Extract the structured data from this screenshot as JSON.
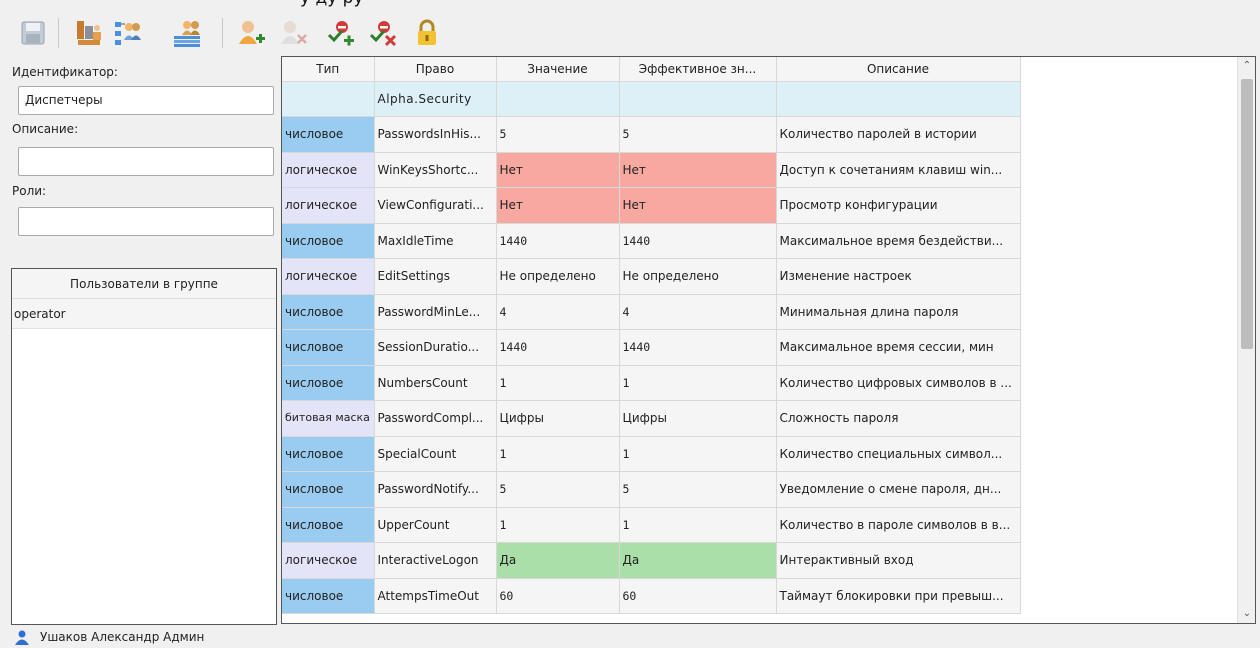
{
  "window": {
    "title_fragment": "у                 ду          ру"
  },
  "toolbar": {
    "buttons": [
      {
        "name": "save",
        "icon": "floppy-disk-icon",
        "enabled": false
      },
      {
        "name": "group-hierarchy",
        "icon": "building-group-icon",
        "enabled": true
      },
      {
        "name": "group-tree",
        "icon": "group-tree-icon",
        "enabled": true
      },
      {
        "name": "group-list",
        "icon": "group-list-icon",
        "enabled": true
      },
      {
        "name": "add-user",
        "icon": "user-add-icon",
        "enabled": true
      },
      {
        "name": "remove-user",
        "icon": "user-remove-icon",
        "enabled": false
      },
      {
        "name": "add-right",
        "icon": "right-add-icon",
        "enabled": true
      },
      {
        "name": "remove-right",
        "icon": "right-remove-icon",
        "enabled": true
      },
      {
        "name": "lock",
        "icon": "padlock-icon",
        "enabled": true
      }
    ]
  },
  "left": {
    "identifier_label": "Идентификатор:",
    "identifier_value": "Диспетчеры",
    "description_label": "Описание:",
    "description_value": "",
    "roles_label": "Роли:",
    "roles_value": "",
    "users_header": "Пользователи в группе",
    "users": [
      "operator"
    ]
  },
  "table": {
    "headers": [
      "Тип",
      "Право",
      "Значение",
      "Эффективное зн...",
      "Описание"
    ],
    "group_row": "Alpha.Security",
    "rows": [
      {
        "type": "числовое",
        "type_kind": "num",
        "right": "PasswordsInHis...",
        "value": "5",
        "effective": "5",
        "value_state": "",
        "value_mono": true,
        "desc": "Количество паролей в истории"
      },
      {
        "type": "логическое",
        "type_kind": "bool",
        "right": "WinKeysShortc...",
        "value": "Нет",
        "effective": "Нет",
        "value_state": "no",
        "value_mono": false,
        "desc": "Доступ к сочетаниям клавиш win..."
      },
      {
        "type": "логическое",
        "type_kind": "bool",
        "right": "ViewConfigurati...",
        "value": "Нет",
        "effective": "Нет",
        "value_state": "no",
        "value_mono": false,
        "desc": "Просмотр конфигурации"
      },
      {
        "type": "числовое",
        "type_kind": "num",
        "right": "MaxIdleTime",
        "value": "1440",
        "effective": "1440",
        "value_state": "",
        "value_mono": true,
        "desc": "Максимальное время бездействи..."
      },
      {
        "type": "логическое",
        "type_kind": "bool",
        "right": "EditSettings",
        "value": "Не определено",
        "effective": "Не определено",
        "value_state": "",
        "value_mono": false,
        "desc": "Изменение настроек"
      },
      {
        "type": "числовое",
        "type_kind": "num",
        "right": "PasswordMinLe...",
        "value": "4",
        "effective": "4",
        "value_state": "",
        "value_mono": true,
        "desc": "Минимальная длина пароля"
      },
      {
        "type": "числовое",
        "type_kind": "num",
        "right": "SessionDuratio...",
        "value": "1440",
        "effective": "1440",
        "value_state": "",
        "value_mono": true,
        "desc": "Максимальное время сессии, мин"
      },
      {
        "type": "числовое",
        "type_kind": "num",
        "right": "NumbersCount",
        "value": "1",
        "effective": "1",
        "value_state": "",
        "value_mono": true,
        "desc": "Количество цифровых символов в ..."
      },
      {
        "type": "битовая маска",
        "type_kind": "mask",
        "right": "PasswordCompl...",
        "value": "Цифры",
        "effective": "Цифры",
        "value_state": "",
        "value_mono": false,
        "desc": "Сложность пароля"
      },
      {
        "type": "числовое",
        "type_kind": "num",
        "right": "SpecialCount",
        "value": "1",
        "effective": "1",
        "value_state": "",
        "value_mono": true,
        "desc": "Количество специальных символ..."
      },
      {
        "type": "числовое",
        "type_kind": "num",
        "right": "PasswordNotify...",
        "value": "5",
        "effective": "5",
        "value_state": "",
        "value_mono": true,
        "desc": "Уведомление о смене пароля, дн..."
      },
      {
        "type": "числовое",
        "type_kind": "num",
        "right": "UpperCount",
        "value": "1",
        "effective": "1",
        "value_state": "",
        "value_mono": true,
        "desc": "Количество в пароле символов в в..."
      },
      {
        "type": "логическое",
        "type_kind": "bool",
        "right": "InteractiveLogon",
        "value": "Да",
        "effective": "Да",
        "value_state": "yes",
        "value_mono": false,
        "desc": "Интерактивный вход"
      },
      {
        "type": "числовое",
        "type_kind": "num",
        "right": "AttempsTimeOut",
        "value": "60",
        "effective": "60",
        "value_state": "",
        "value_mono": true,
        "desc": "Таймаут блокировки при превыш..."
      }
    ]
  },
  "status": {
    "user": "Ушаков Александр Админ"
  },
  "colors": {
    "numeric_type": "#99ccf0",
    "boolean_type": "#e4e4f8",
    "value_no": "#f7a9a1",
    "value_yes": "#aadfa9",
    "group_row": "#ddf0f8"
  }
}
